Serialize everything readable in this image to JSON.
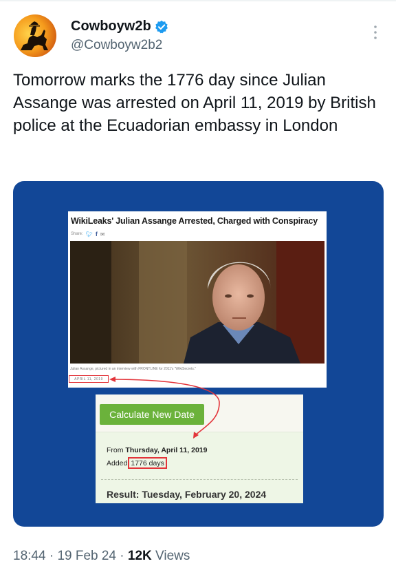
{
  "author": {
    "display_name": "Cowboyw2b",
    "handle": "@Cowboyw2b2",
    "avatar_icon": "cowboy-silhouette-avatar",
    "verified_icon": "verified-badge-icon",
    "verified_color": "#1d9bf0"
  },
  "tweet": {
    "text": "Tomorrow marks the 1776 day since Julian Assange was arrested on April 11, 2019 by British police at the Ecuadorian embassy in London"
  },
  "media": {
    "background_color": "#124797",
    "article": {
      "headline": "WikiLeaks' Julian Assange Arrested, Charged with Conspiracy",
      "share_label": "Share:",
      "caption": "Julian Assange, pictured in an interview with FRONTLINE for 2011's \"WikiSecrets.\"",
      "date": "APRIL 11, 2019"
    },
    "calculator": {
      "button_label": "Calculate New Date",
      "from_prefix": "From",
      "from_date": "Thursday, April 11, 2019",
      "added_prefix": "Added",
      "days_added": "1776 days",
      "result": "Result: Tuesday, February 20, 2024",
      "button_color": "#6bb23b",
      "highlight_color": "#e3343a"
    }
  },
  "meta": {
    "time": "18:44",
    "sep1": "·",
    "date": "19 Feb 24",
    "sep2": "·",
    "views_count": "12K",
    "views_label": "Views"
  }
}
